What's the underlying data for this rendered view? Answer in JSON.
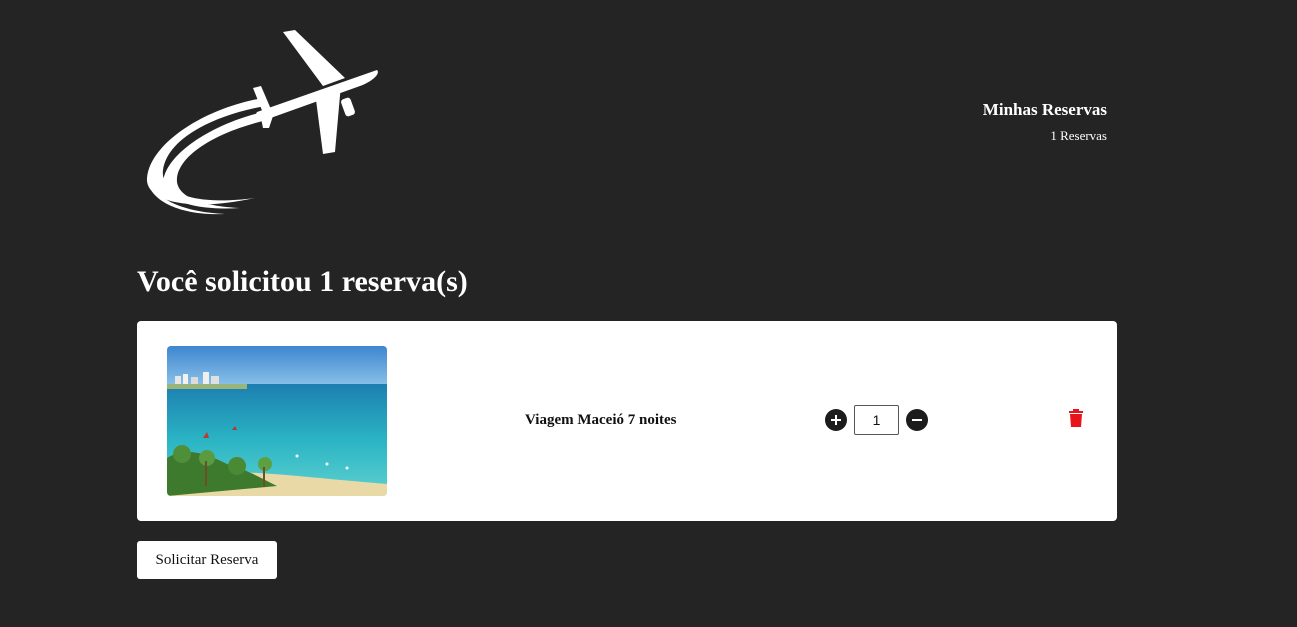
{
  "header": {
    "reservations_link": "Minhas Reservas",
    "reservations_count": "1 Reservas"
  },
  "main": {
    "title": "Você solicitou 1 reserva(s)",
    "items": [
      {
        "title": "Viagem Maceió 7 noites",
        "quantity": "1",
        "image_icon": "beach-photo"
      }
    ],
    "submit_label": "Solicitar Reserva"
  },
  "icons": {
    "logo": "airplane-logo-icon",
    "increase": "plus-circle-icon",
    "decrease": "minus-circle-icon",
    "delete": "trash-icon"
  },
  "colors": {
    "background": "#242424",
    "card": "#ffffff",
    "delete": "#e8141c"
  }
}
